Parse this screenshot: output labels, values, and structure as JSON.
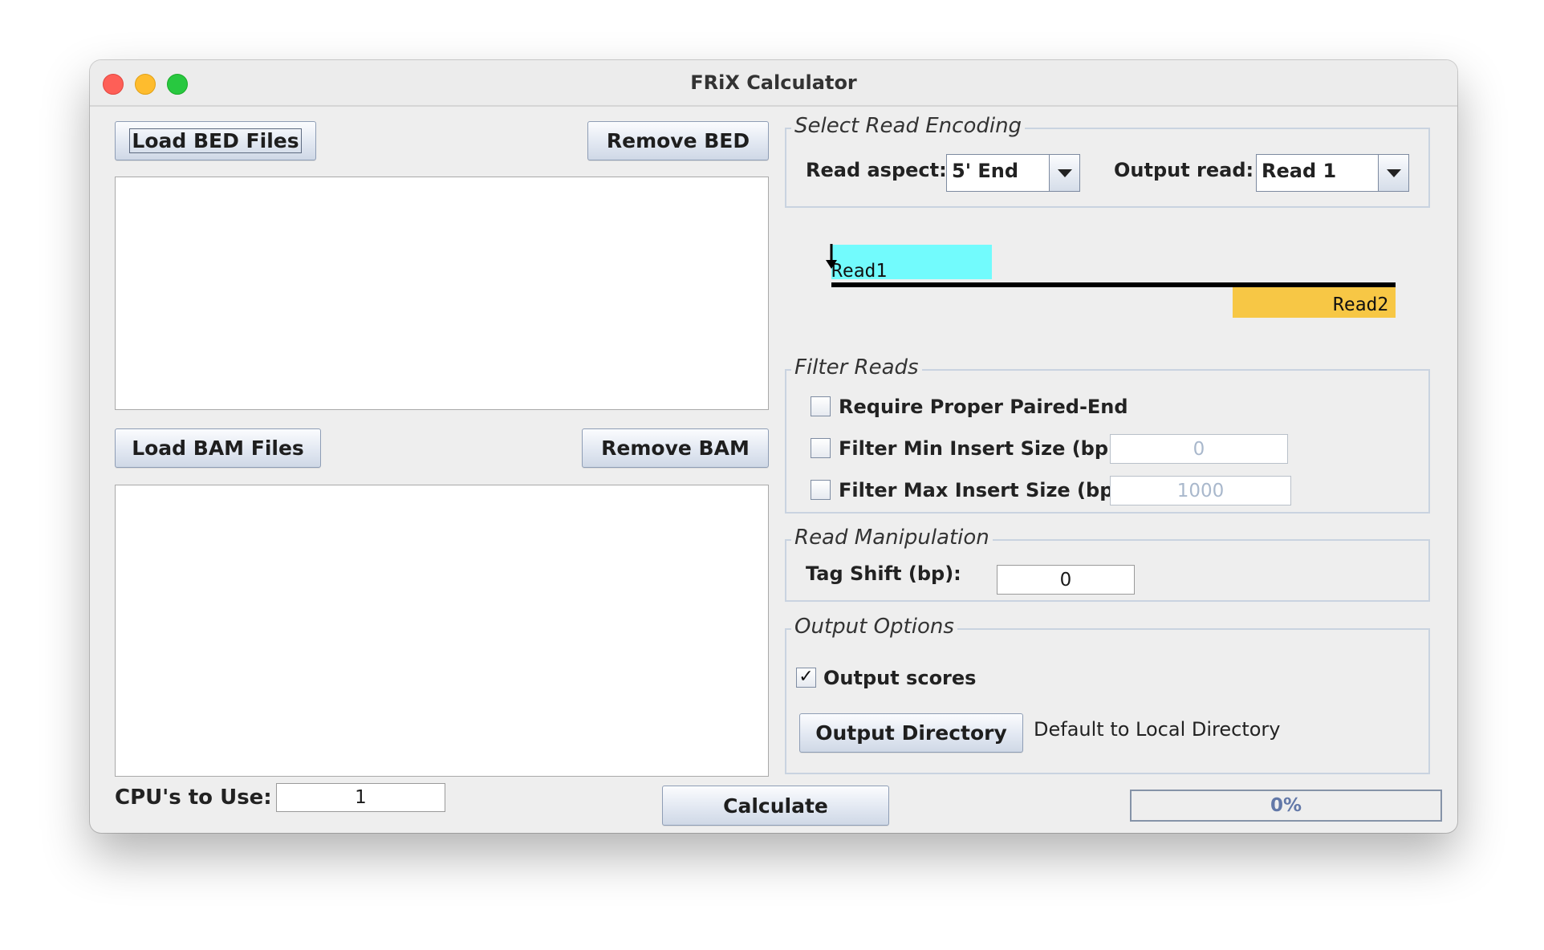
{
  "window": {
    "title": "FRiX Calculator"
  },
  "bed": {
    "load_label": "Load BED Files",
    "remove_label": "Remove BED"
  },
  "bam": {
    "load_label": "Load BAM Files",
    "remove_label": "Remove BAM"
  },
  "cpu": {
    "label": "CPU's to Use:",
    "value": "1"
  },
  "calculate_label": "Calculate",
  "progress": {
    "text": "0%",
    "value": 0
  },
  "encoding": {
    "legend": "Select Read Encoding",
    "aspect_label": "Read aspect:",
    "aspect_value": "5' End",
    "output_label": "Output read:",
    "output_value": "Read 1"
  },
  "diagram": {
    "read1_label": "Read1",
    "read2_label": "Read2",
    "read1_color": "#72fbfd",
    "read2_color": "#f7c745"
  },
  "filter": {
    "legend": "Filter Reads",
    "proper_label": "Require Proper Paired-End",
    "proper_checked": false,
    "min_label": "Filter Min Insert Size (bp)",
    "min_checked": false,
    "min_value": "0",
    "max_label": "Filter Max Insert Size (bp)",
    "max_checked": false,
    "max_value": "1000"
  },
  "manipulation": {
    "legend": "Read Manipulation",
    "shift_label": "Tag Shift (bp):",
    "shift_value": "0"
  },
  "output": {
    "legend": "Output Options",
    "scores_label": "Output scores",
    "scores_checked": true,
    "directory_label": "Output Directory",
    "directory_value": "Default to Local Directory"
  }
}
